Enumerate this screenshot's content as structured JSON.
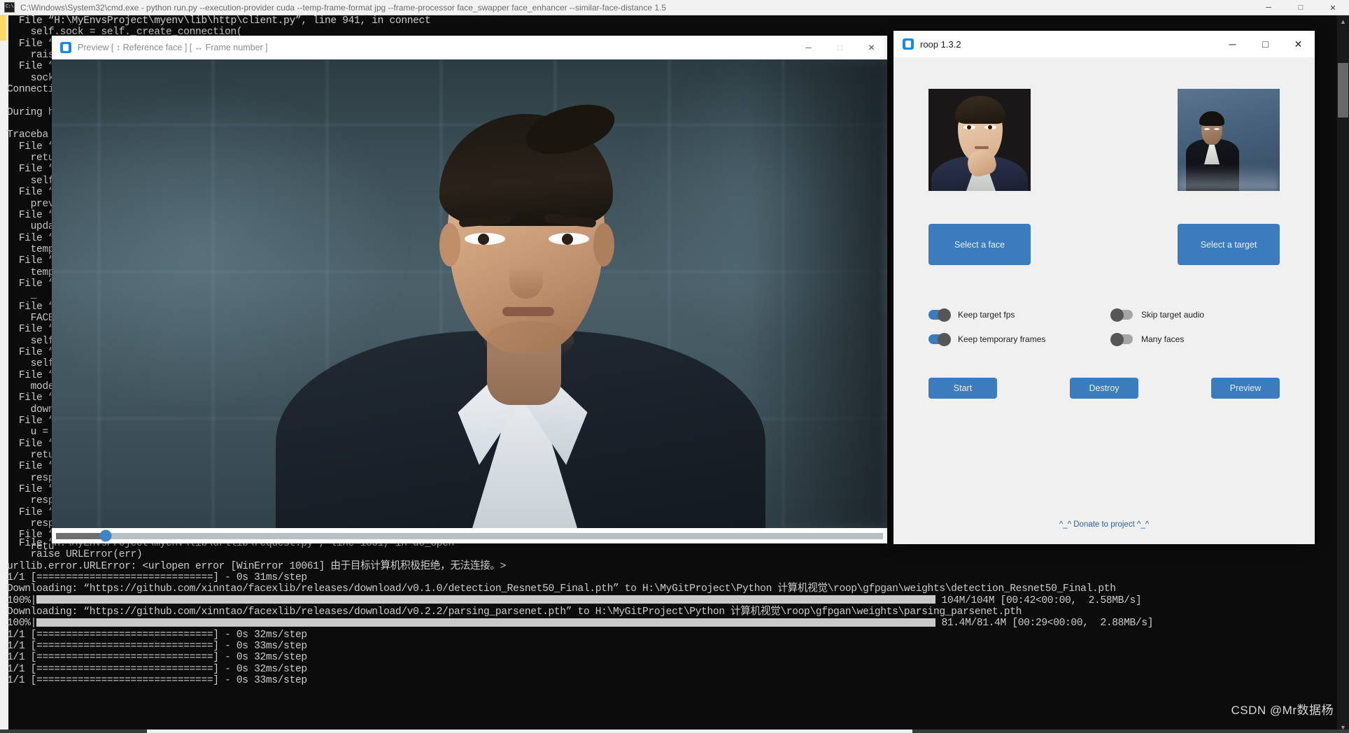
{
  "cmd_window": {
    "icon": "cmd-icon",
    "title": "C:\\Windows\\System32\\cmd.exe - python  run.py --execution-provider cuda --temp-frame-format jpg --frame-processor face_swapper face_enhancer --similar-face-distance 1.5",
    "minimize": "─",
    "maximize": "□",
    "close": "✕",
    "console_lines": [
      "  File “H:\\MyEnvsProject\\myenv\\lib\\http\\client.py”, line 941, in connect",
      "    self.sock = self._create_connection(",
      "  File “",
      "    rais",
      "  File “",
      "    sock",
      "Connecti",
      "",
      "During h",
      "",
      "Traceba",
      "  File “",
      "    retu",
      "  File “",
      "    self",
      "  File “",
      "    prev",
      "  File “",
      "    upda",
      "  File “",
      "    temp",
      "  File “",
      "    temp",
      "  File “",
      "    _",
      "  File “",
      "    FACE",
      "  File “",
      "    self",
      "  File “",
      "    self",
      "  File “",
      "    mode",
      "  File “",
      "    down",
      "  File “",
      "    u =",
      "  File “",
      "    retu",
      "  File “",
      "    resp",
      "  File “",
      "    resp",
      "  File “",
      "    resp",
      "  File “",
      "    retu"
    ],
    "console_tail": [
      "  File “H:\\MyEnvsProject\\myenv\\lib\\urllib\\request.py”, line 1351, in do_open",
      "    raise URLError(err)",
      "urllib.error.URLError: <urlopen error [WinError 10061] 由于目标计算机积极拒绝，无法连接。>",
      "1/1 [==============================] - 0s 31ms/step",
      "Downloading: “https://github.com/xinntao/facexlib/releases/download/v0.1.0/detection_Resnet50_Final.pth” to H:\\MyGitProject\\Python 计算机视觉\\roop\\gfpgan\\weights\\detection_Resnet50_Final.pth"
    ],
    "progress_1": {
      "percent": "100%",
      "stats": "104M/104M [00:42<00:00,  2.58MB/s]"
    },
    "download_2": "Downloading: “https://github.com/xinntao/facexlib/releases/download/v0.2.2/parsing_parsenet.pth” to H:\\MyGitProject\\Python 计算机视觉\\roop\\gfpgan\\weights\\parsing_parsenet.pth",
    "progress_2": {
      "percent": "100%",
      "stats": "81.4M/81.4M [00:29<00:00,  2.88MB/s]"
    },
    "step_lines": [
      "1/1 [==============================] - 0s 32ms/step",
      "1/1 [==============================] - 0s 33ms/step",
      "1/1 [==============================] - 0s 32ms/step",
      "1/1 [==============================] - 0s 32ms/step",
      "1/1 [==============================] - 0s 33ms/step"
    ]
  },
  "preview_window": {
    "logo": "roop-logo-icon",
    "title": "Preview [ ↕ Reference face ] [ ↔ Frame number ]",
    "minimize": "─",
    "maximize": "□",
    "close": "✕",
    "seek_position_percent": 6
  },
  "roop_window": {
    "logo": "roop-logo-icon",
    "title": "roop 1.3.2",
    "minimize": "─",
    "maximize": "□",
    "close": "✕",
    "source_thumbnail_alt": "source-face-preview",
    "target_thumbnail_alt": "target-preview",
    "select_face_label": "Select a face",
    "select_target_label": "Select a target",
    "toggles": [
      {
        "label": "Keep target fps",
        "state": "on"
      },
      {
        "label": "Skip target audio",
        "state": "off"
      },
      {
        "label": "Keep temporary frames",
        "state": "on"
      },
      {
        "label": "Many faces",
        "state": "off"
      }
    ],
    "actions": [
      {
        "label": "Start"
      },
      {
        "label": "Destroy"
      },
      {
        "label": "Preview"
      }
    ],
    "donate_label": "^_^ Donate to project ^_^",
    "accent_color": "#3a7cbe",
    "link_color": "#2c5f9e"
  },
  "watermark": "CSDN @Mr数据杨"
}
